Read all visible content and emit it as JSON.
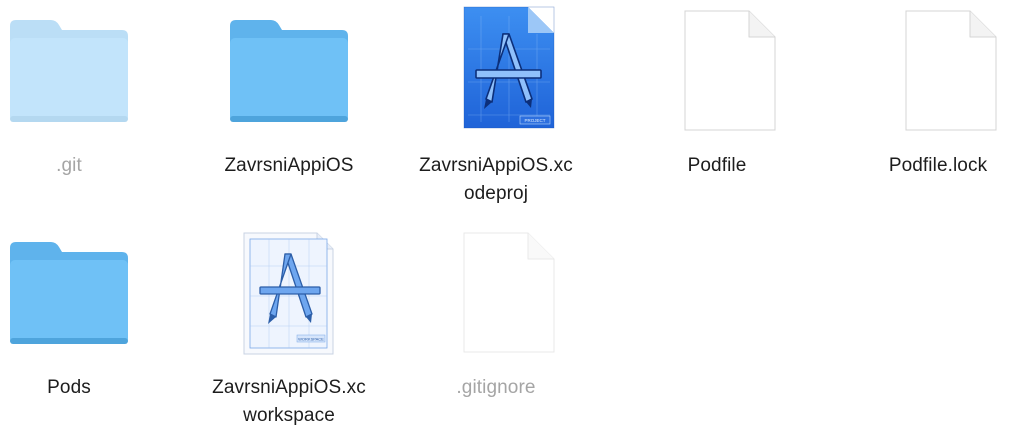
{
  "window": {
    "view": "icon-view"
  },
  "colors": {
    "folder_top": "#5fb3ec",
    "folder_body": "#6fc1f6",
    "folder_shadow": "#4ea4dc",
    "hidden_folder_tint": "#c9e6fb",
    "xcode_blue": "#2f7cec",
    "label_text": "#1d1d1d",
    "hidden_label_text": "#a5a5a5"
  },
  "files": [
    {
      "name_lines": [
        ".git"
      ],
      "kind": "folder",
      "icon": "folder-icon",
      "hidden": true
    },
    {
      "name_lines": [
        "ZavrsniAppiOS"
      ],
      "kind": "folder",
      "icon": "folder-icon",
      "hidden": false
    },
    {
      "name_lines": [
        "ZavrsniAppiOS.xc",
        "odeproj"
      ],
      "kind": "xcodeproj",
      "icon": "xcode-project-icon",
      "hidden": false,
      "badge": "PROJECT"
    },
    {
      "name_lines": [
        "Podfile"
      ],
      "kind": "document",
      "icon": "blank-document-icon",
      "hidden": false
    },
    {
      "name_lines": [
        "Podfile.lock"
      ],
      "kind": "document",
      "icon": "blank-document-icon",
      "hidden": false
    },
    {
      "name_lines": [
        "Pods"
      ],
      "kind": "folder",
      "icon": "folder-icon",
      "hidden": false
    },
    {
      "name_lines": [
        "ZavrsniAppiOS.xc",
        "workspace"
      ],
      "kind": "xcworkspace",
      "icon": "xcode-workspace-icon",
      "hidden": false,
      "badge": "WORKSPACE"
    },
    {
      "name_lines": [
        ".gitignore"
      ],
      "kind": "document",
      "icon": "blank-document-icon",
      "hidden": true
    }
  ]
}
